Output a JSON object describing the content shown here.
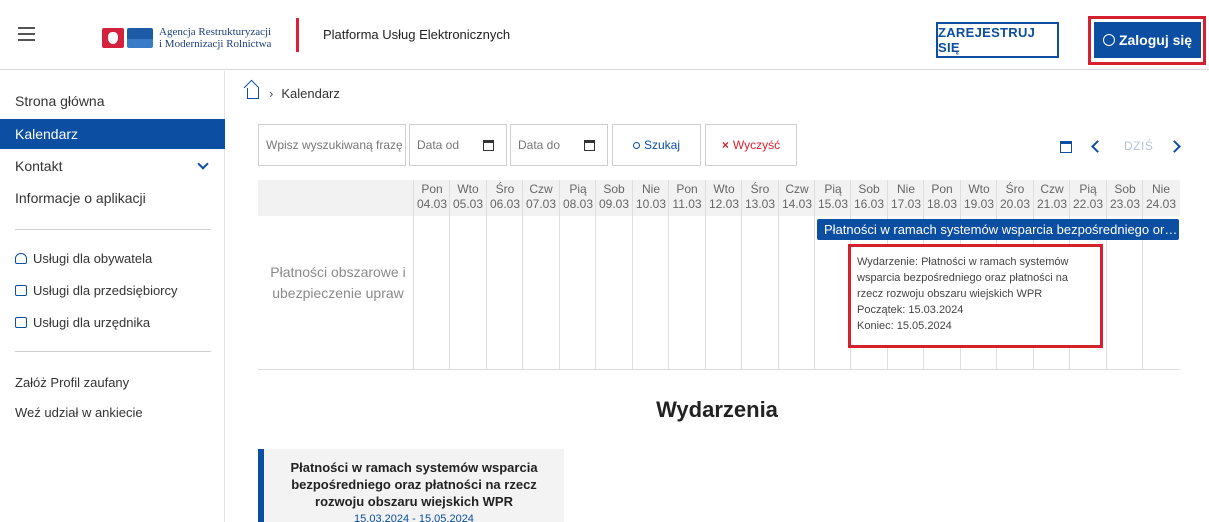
{
  "header": {
    "logo_line1": "Agencja Restrukturyzacji",
    "logo_line2": "i Modernizacji Rolnictwa",
    "platform_title": "Platforma Usług Elektronicznych",
    "register_label": "ZAREJESTRUJ SIĘ",
    "login_label": "Zaloguj się"
  },
  "sidebar": {
    "items": [
      {
        "label": "Strona główna"
      },
      {
        "label": "Kalendarz"
      },
      {
        "label": "Kontakt"
      },
      {
        "label": "Informacje o aplikacji"
      }
    ],
    "services": [
      {
        "label": "Usługi dla obywatela"
      },
      {
        "label": "Usługi dla przedsiębiorcy"
      },
      {
        "label": "Usługi dla urzędnika"
      }
    ],
    "links": [
      {
        "label": "Załóż Profil zaufany"
      },
      {
        "label": "Weź udział w ankiecie"
      }
    ]
  },
  "breadcrumb": {
    "current": "Kalendarz"
  },
  "filters": {
    "search_placeholder": "Wpisz wyszukiwaną frazę",
    "date_from": "Data od",
    "date_to": "Data do",
    "search_button": "Szukaj",
    "clear_button": "Wyczyść",
    "today_label": "DZIŚ"
  },
  "calendar": {
    "days": [
      {
        "name": "Pon",
        "date": "04.03"
      },
      {
        "name": "Wto",
        "date": "05.03"
      },
      {
        "name": "Śro",
        "date": "06.03"
      },
      {
        "name": "Czw",
        "date": "07.03"
      },
      {
        "name": "Pią",
        "date": "08.03"
      },
      {
        "name": "Sob",
        "date": "09.03"
      },
      {
        "name": "Nie",
        "date": "10.03"
      },
      {
        "name": "Pon",
        "date": "11.03"
      },
      {
        "name": "Wto",
        "date": "12.03"
      },
      {
        "name": "Śro",
        "date": "13.03"
      },
      {
        "name": "Czw",
        "date": "14.03"
      },
      {
        "name": "Pią",
        "date": "15.03"
      },
      {
        "name": "Sob",
        "date": "16.03"
      },
      {
        "name": "Nie",
        "date": "17.03"
      },
      {
        "name": "Pon",
        "date": "18.03"
      },
      {
        "name": "Wto",
        "date": "19.03"
      },
      {
        "name": "Śro",
        "date": "20.03"
      },
      {
        "name": "Czw",
        "date": "21.03"
      },
      {
        "name": "Pią",
        "date": "22.03"
      },
      {
        "name": "Sob",
        "date": "23.03"
      },
      {
        "name": "Nie",
        "date": "24.03"
      }
    ],
    "row_label": "Płatności obszarowe i ubezpieczenie upraw",
    "event_bar": "Płatności w ramach systemów wsparcia bezpośredniego oraz płatności na rzecz rozwoju obszaru wiejskich WPR",
    "tooltip": {
      "line1": "Wydarzenie: Płatności w ramach systemów",
      "line2": "wsparcia bezpośredniego oraz płatności na",
      "line3": "rzecz rozwoju obszaru wiejskich WPR",
      "start": "Początek: 15.03.2024",
      "end": "Koniec: 15.05.2024"
    }
  },
  "events": {
    "title": "Wydarzenia",
    "cards": [
      {
        "title": "Płatności w ramach systemów wsparcia bezpośredniego oraz płatności na rzecz rozwoju obszaru wiejskich WPR",
        "dates": "15.03.2024 - 15.05.2024"
      }
    ]
  },
  "colors": {
    "primary": "#0b4ea2",
    "highlight_red": "#d4202f"
  }
}
